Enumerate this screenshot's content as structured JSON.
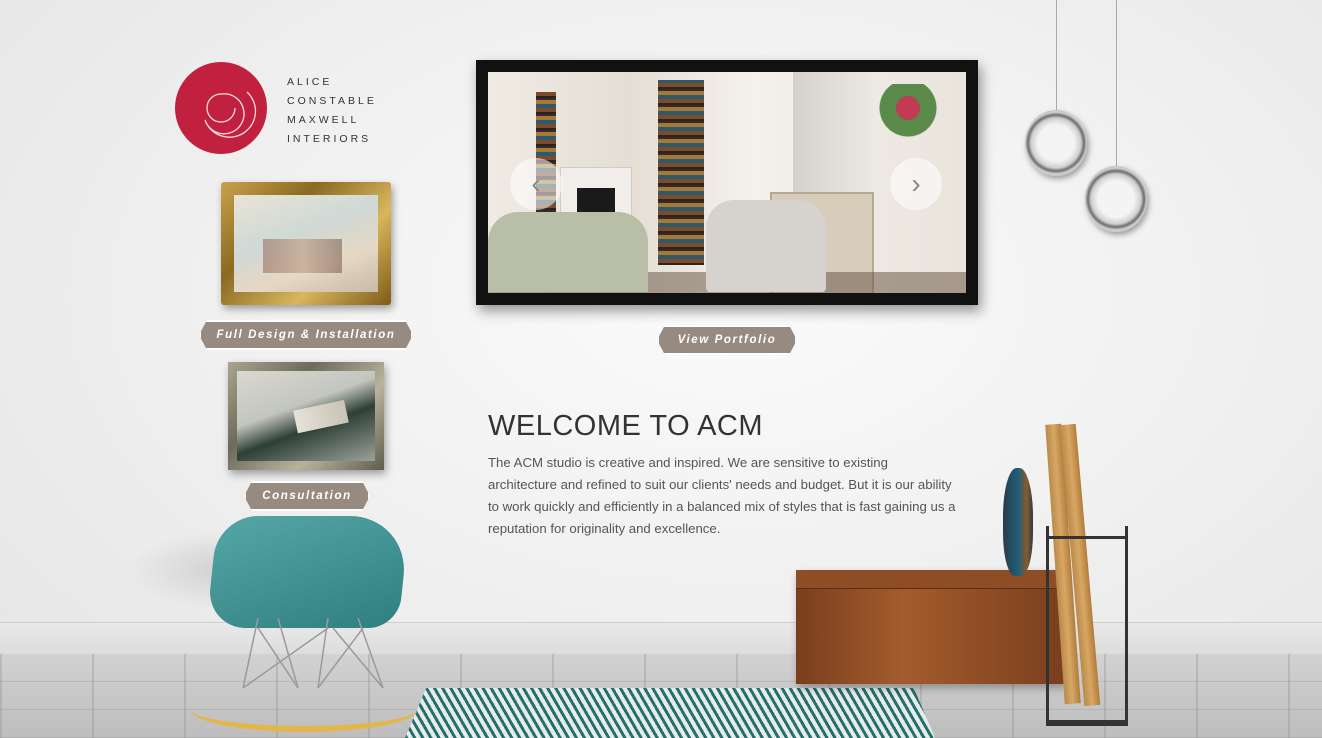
{
  "brand": {
    "line1": "ALICE",
    "line2": "CONSTABLE",
    "line3": "MAXWELL",
    "line4": "INTERIORS",
    "color": "#c1203f"
  },
  "services": {
    "design_label": "Full Design & Installation",
    "consultation_label": "Consultation"
  },
  "slideshow": {
    "prev_icon": "chevron-left-icon",
    "next_icon": "chevron-right-icon",
    "prev_glyph": "‹",
    "next_glyph": "›",
    "portfolio_label": "View Portfolio"
  },
  "welcome": {
    "title": "WELCOME TO ACM",
    "body": "The ACM studio is creative and inspired. We are sensitive to existing architecture and refined to suit our clients' needs and budget. But it is our ability to work quickly and efficiently in a balanced mix of styles that is fast gaining us a reputation for originality and excellence."
  },
  "colors": {
    "plaque": "#968a81",
    "accent": "#c1203f",
    "chair": "#3f9595"
  }
}
